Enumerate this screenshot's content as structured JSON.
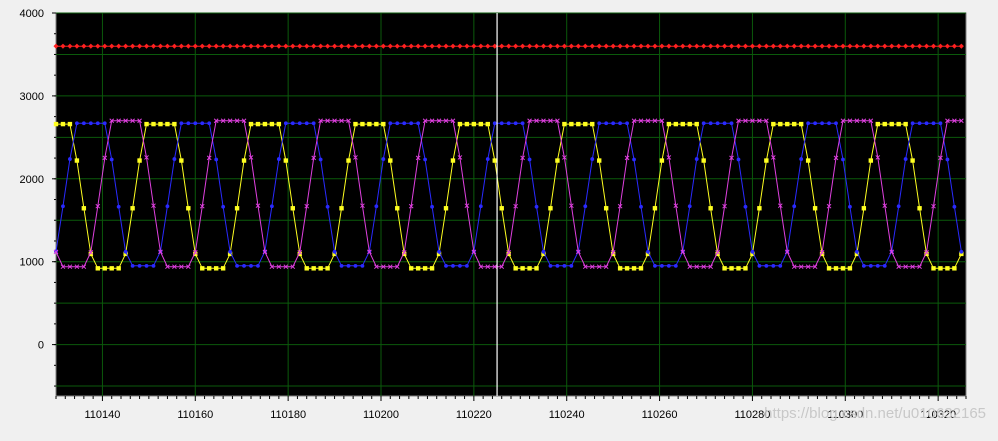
{
  "chart_data": {
    "type": "line",
    "title": "",
    "xlabel": "",
    "ylabel": "",
    "xlim": [
      110130,
      110326
    ],
    "ylim": [
      -620,
      4000
    ],
    "y_ticks": [
      0,
      1000,
      2000,
      3000,
      4000
    ],
    "y_tick_labels": [
      "0",
      "1000",
      "2000",
      "3000",
      "4000"
    ],
    "x_ticks": [
      110140,
      110160,
      110180,
      110200,
      110220,
      110240,
      110260,
      110280,
      110300,
      110320
    ],
    "x_tick_labels": [
      "110140",
      "110160",
      "110180",
      "110200",
      "110220",
      "110240",
      "110260",
      "110280",
      "110300",
      "110320"
    ],
    "cursor_x": 110225,
    "grid": true,
    "legend": "none",
    "background_color": "#000000",
    "grid_color": "#0b5a0b",
    "cursor_color": "#ffffff",
    "series": [
      {
        "color": "#ff2020",
        "marker": "diamond",
        "constant": 3600
      },
      {
        "color": "#ffff20",
        "marker": "square",
        "min": 920,
        "max": 2660,
        "period": 22.5,
        "phase": 0.0
      },
      {
        "color": "#2a2aff",
        "marker": "dot",
        "min": 950,
        "max": 2670,
        "period": 22.5,
        "phase": 0.333
      },
      {
        "color": "#e040e0",
        "marker": "cross",
        "min": 940,
        "max": 2700,
        "period": 22.5,
        "phase": 0.667
      }
    ]
  },
  "watermark": "https://blog.csdn.net/u010632165"
}
